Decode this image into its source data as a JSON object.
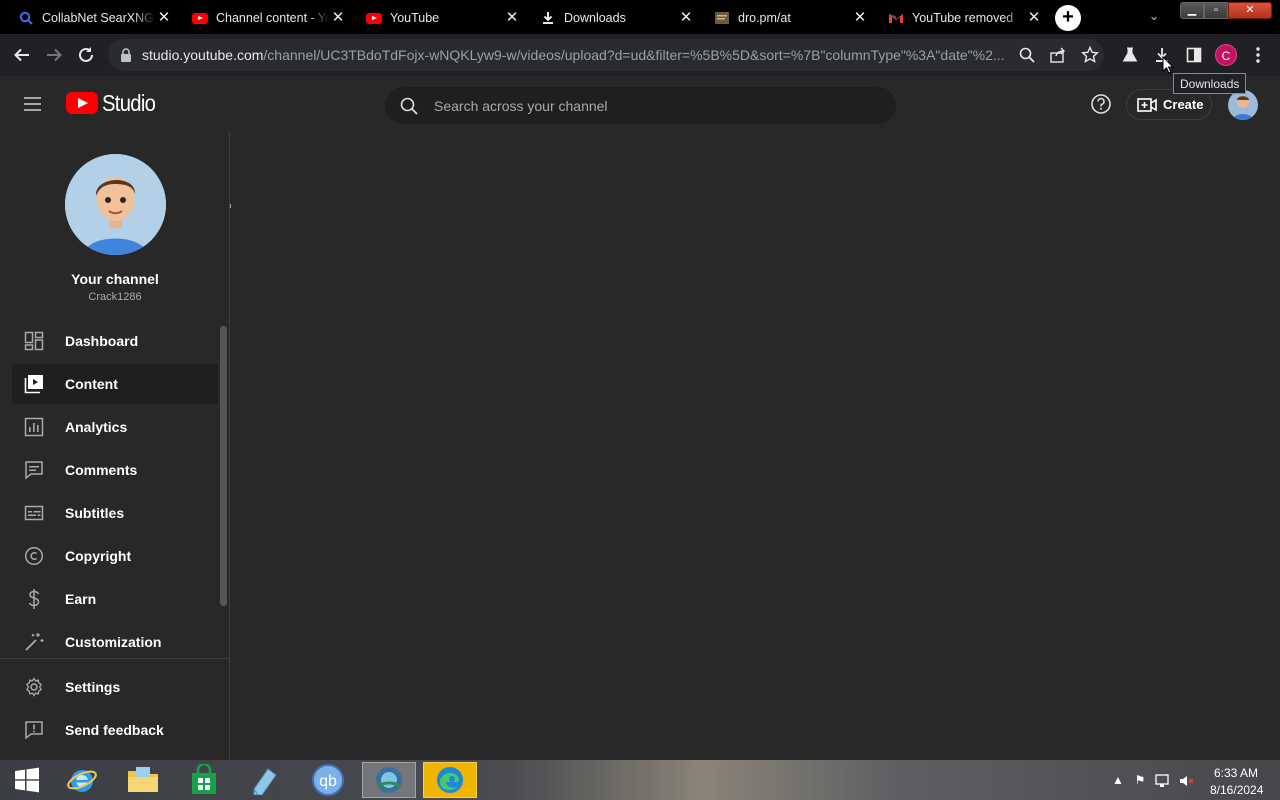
{
  "browser": {
    "tabs": [
      {
        "title": "CollabNet SearXNG",
        "favicon": "search-favicon",
        "active": false
      },
      {
        "title": "Channel content - YouTube Studio",
        "favicon": "youtube-favicon",
        "active": false
      },
      {
        "title": "YouTube",
        "favicon": "youtube-favicon",
        "active": true
      },
      {
        "title": "Downloads",
        "favicon": "download-favicon",
        "active": false
      },
      {
        "title": "dro.pm/at",
        "favicon": "page-favicon",
        "active": false
      },
      {
        "title": "YouTube removed",
        "favicon": "gmail-favicon",
        "active": false
      }
    ],
    "url_host": "studio.youtube.com",
    "url_path": "/channel/UC3TBdoTdFojx-wNQKLyw9-w/videos/upload?d=ud&filter=%5B%5D&sort=%7B\"columnType\"%3A\"date\"%2...",
    "profile_initial": "C",
    "tooltip": "Downloads"
  },
  "studio": {
    "logo_text": "Studio",
    "search_placeholder": "Search across your channel",
    "create_label": "Create",
    "loading_progress": 0.66
  },
  "sidebar": {
    "channel_title": "Your channel",
    "channel_handle": "Crack1286",
    "items": [
      {
        "label": "Dashboard",
        "icon": "dashboard-icon"
      },
      {
        "label": "Content",
        "icon": "content-icon",
        "active": true
      },
      {
        "label": "Analytics",
        "icon": "analytics-icon"
      },
      {
        "label": "Comments",
        "icon": "comments-icon"
      },
      {
        "label": "Subtitles",
        "icon": "subtitles-icon"
      },
      {
        "label": "Copyright",
        "icon": "copyright-icon"
      },
      {
        "label": "Earn",
        "icon": "earn-icon"
      },
      {
        "label": "Customization",
        "icon": "customization-icon"
      }
    ],
    "bottom_items": [
      {
        "label": "Settings",
        "icon": "gear-icon"
      },
      {
        "label": "Send feedback",
        "icon": "feedback-icon"
      }
    ]
  },
  "taskbar": {
    "time": "6:33 AM",
    "date": "8/16/2024"
  }
}
